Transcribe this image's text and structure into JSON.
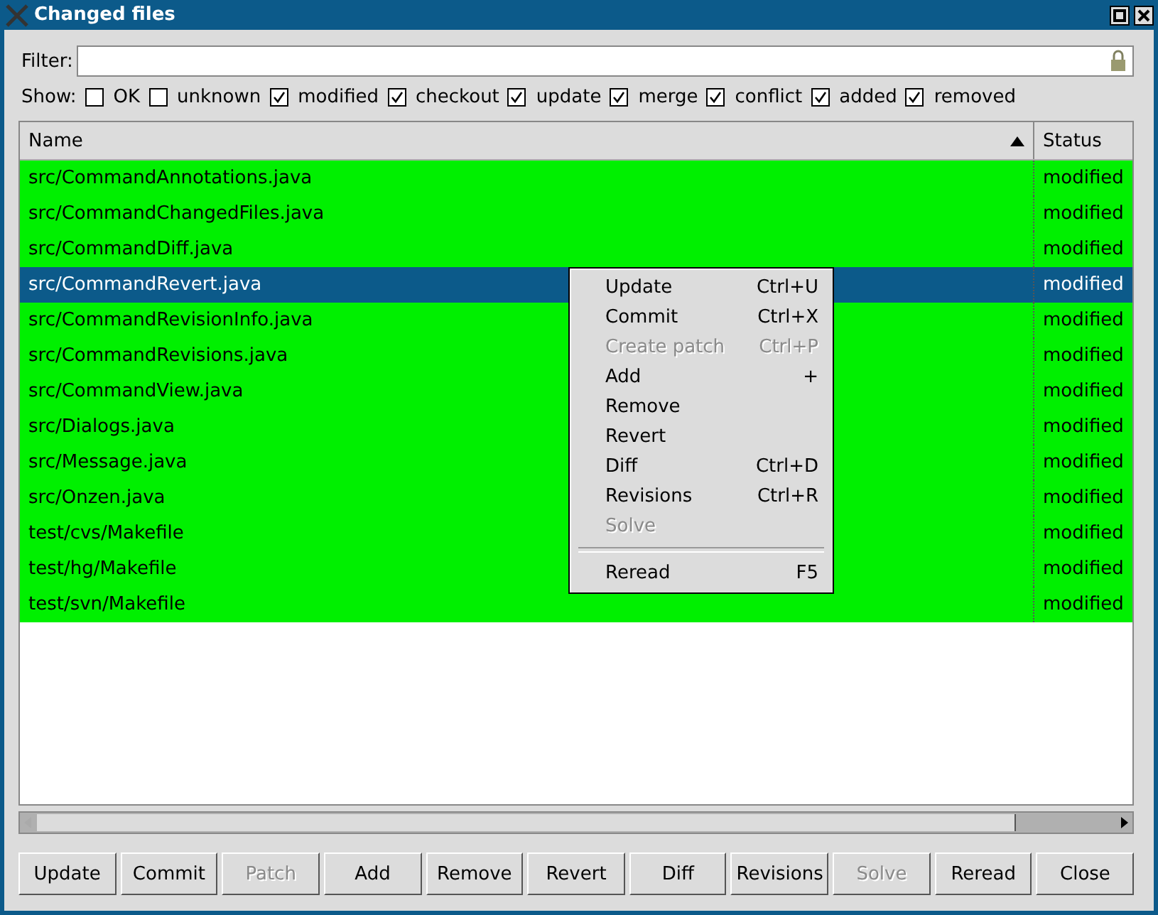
{
  "window": {
    "title": "Changed files"
  },
  "filter": {
    "label": "Filter:"
  },
  "show": {
    "label": "Show:",
    "options": [
      {
        "label": "OK",
        "checked": false
      },
      {
        "label": "unknown",
        "checked": false
      },
      {
        "label": "modified",
        "checked": true
      },
      {
        "label": "checkout",
        "checked": true
      },
      {
        "label": "update",
        "checked": true
      },
      {
        "label": "merge",
        "checked": true
      },
      {
        "label": "conflict",
        "checked": true
      },
      {
        "label": "added",
        "checked": true
      },
      {
        "label": "removed",
        "checked": true
      }
    ]
  },
  "table": {
    "columns": [
      {
        "label": "Name",
        "sorted": true
      },
      {
        "label": "Status"
      }
    ],
    "rows": [
      {
        "name": "src/CommandAnnotations.java",
        "status": "modified",
        "selected": false
      },
      {
        "name": "src/CommandChangedFiles.java",
        "status": "modified",
        "selected": false
      },
      {
        "name": "src/CommandDiff.java",
        "status": "modified",
        "selected": false
      },
      {
        "name": "src/CommandRevert.java",
        "status": "modified",
        "selected": true
      },
      {
        "name": "src/CommandRevisionInfo.java",
        "status": "modified",
        "selected": false
      },
      {
        "name": "src/CommandRevisions.java",
        "status": "modified",
        "selected": false
      },
      {
        "name": "src/CommandView.java",
        "status": "modified",
        "selected": false
      },
      {
        "name": "src/Dialogs.java",
        "status": "modified",
        "selected": false
      },
      {
        "name": "src/Message.java",
        "status": "modified",
        "selected": false
      },
      {
        "name": "src/Onzen.java",
        "status": "modified",
        "selected": false
      },
      {
        "name": "test/cvs/Makefile",
        "status": "modified",
        "selected": false
      },
      {
        "name": "test/hg/Makefile",
        "status": "modified",
        "selected": false
      },
      {
        "name": "test/svn/Makefile",
        "status": "modified",
        "selected": false
      }
    ]
  },
  "context_menu": {
    "items": [
      {
        "kind": "item",
        "label": "Update",
        "shortcut": "Ctrl+U",
        "disabled": false
      },
      {
        "kind": "item",
        "label": "Commit",
        "shortcut": "Ctrl+X",
        "disabled": false
      },
      {
        "kind": "item",
        "label": "Create patch",
        "shortcut": "Ctrl+P",
        "disabled": true
      },
      {
        "kind": "item",
        "label": "Add",
        "shortcut": "+",
        "disabled": false
      },
      {
        "kind": "item",
        "label": "Remove",
        "disabled": false
      },
      {
        "kind": "item",
        "label": "Revert",
        "disabled": false
      },
      {
        "kind": "item",
        "label": "Diff",
        "shortcut": "Ctrl+D",
        "disabled": false
      },
      {
        "kind": "item",
        "label": "Revisions",
        "shortcut": "Ctrl+R",
        "disabled": false
      },
      {
        "kind": "item",
        "label": "Solve",
        "disabled": true
      },
      {
        "kind": "separator"
      },
      {
        "kind": "item",
        "label": "Reread",
        "shortcut": "F5",
        "disabled": false
      }
    ]
  },
  "buttons": [
    {
      "label": "Update",
      "disabled": false
    },
    {
      "label": "Commit",
      "disabled": false
    },
    {
      "label": "Patch",
      "disabled": true
    },
    {
      "label": "Add",
      "disabled": false
    },
    {
      "label": "Remove",
      "disabled": false
    },
    {
      "label": "Revert",
      "disabled": false
    },
    {
      "label": "Diff",
      "disabled": false
    },
    {
      "label": "Revisions",
      "disabled": false
    },
    {
      "label": "Solve",
      "disabled": true
    },
    {
      "label": "Reread",
      "disabled": false
    },
    {
      "label": "Close",
      "disabled": false
    }
  ]
}
